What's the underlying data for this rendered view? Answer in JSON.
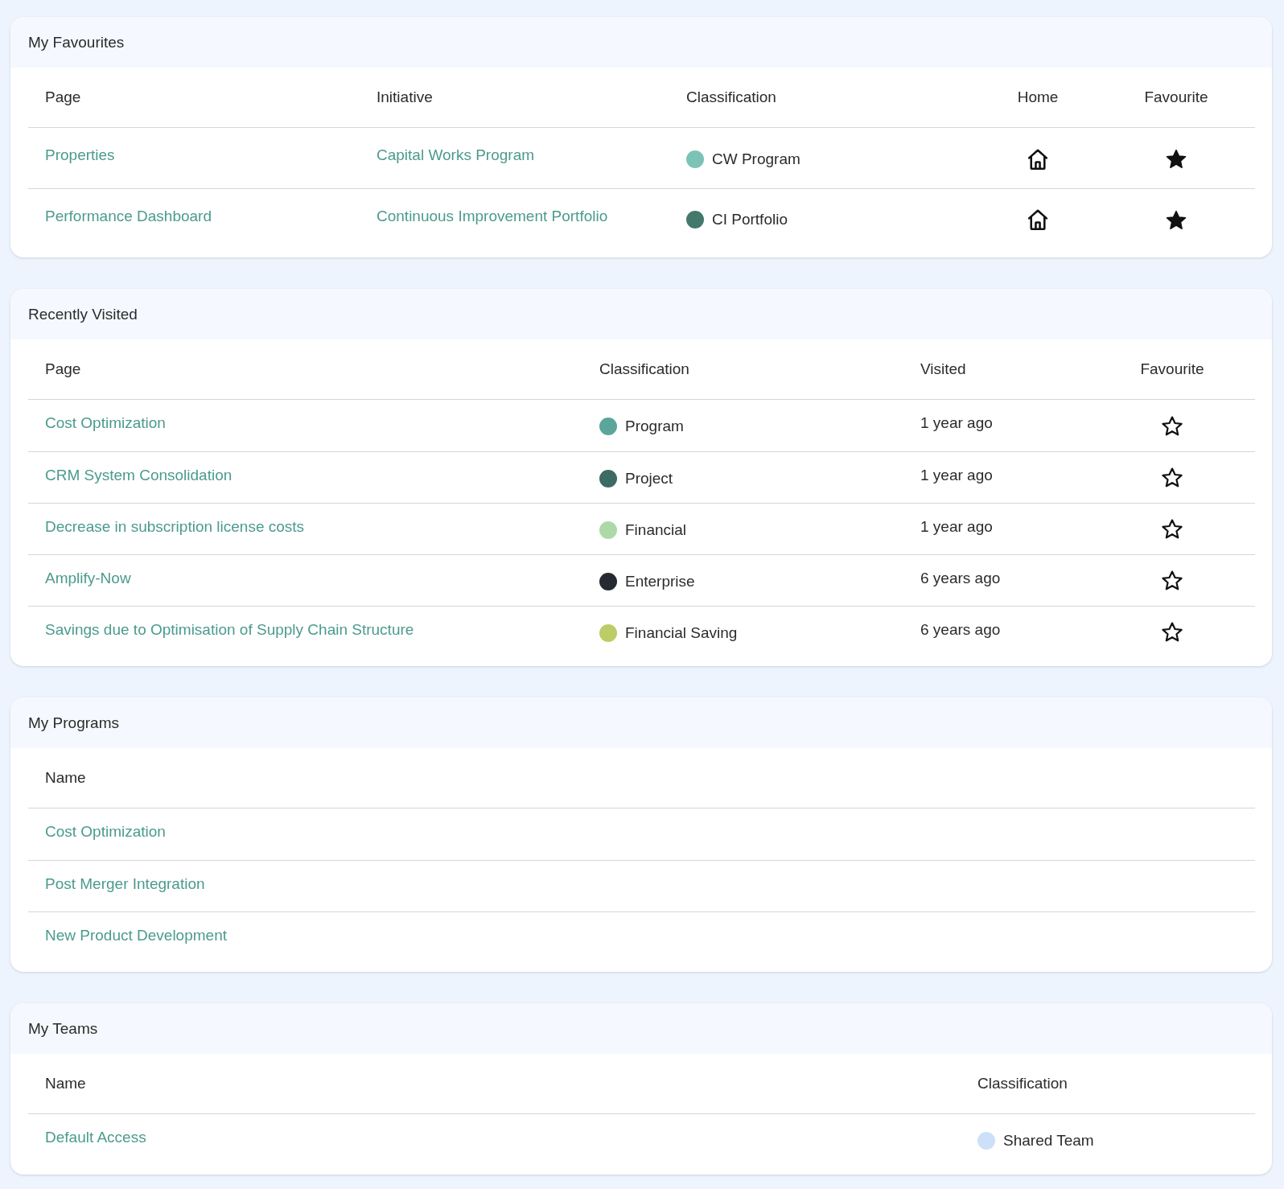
{
  "sections": [
    {
      "kind": "favourites",
      "title": "My Favourites",
      "columns": [
        {
          "label": "Page",
          "kind": "page"
        },
        {
          "label": "Initiative",
          "kind": "initiative"
        },
        {
          "label": "Classification",
          "kind": "classification"
        },
        {
          "label": "Home",
          "kind": "home"
        },
        {
          "label": "Favourite",
          "kind": "favourite"
        }
      ],
      "rows": [
        {
          "page": "Properties",
          "initiative": "Capital Works Program",
          "classification": "CW Program",
          "color": "#7cc3b7",
          "favourite": true
        },
        {
          "page": "Performance Dashboard",
          "initiative": "Continuous Improvement Portfolio",
          "classification": "CI Portfolio",
          "color": "#44786d",
          "favourite": true
        }
      ]
    },
    {
      "kind": "recent",
      "title": "Recently Visited",
      "columns": [
        {
          "label": "Page",
          "kind": "page"
        },
        {
          "label": "Classification",
          "kind": "classification"
        },
        {
          "label": "Visited",
          "kind": "visited"
        },
        {
          "label": "Favourite",
          "kind": "favourite"
        }
      ],
      "rows": [
        {
          "page": "Cost Optimization",
          "classification": "Program",
          "color": "#5ba59a",
          "visited": "1 year ago",
          "favourite": false
        },
        {
          "page": "CRM System Consolidation",
          "classification": "Project",
          "color": "#3b6b63",
          "visited": "1 year ago",
          "favourite": false
        },
        {
          "page": "Decrease in subscription license costs",
          "classification": "Financial",
          "color": "#add9a9",
          "visited": "1 year ago",
          "favourite": false
        },
        {
          "page": "Amplify-Now",
          "classification": "Enterprise",
          "color": "#252a33",
          "visited": "6 years ago",
          "favourite": false
        },
        {
          "page": "Savings due to Optimisation of Supply Chain Structure",
          "classification": "Financial Saving",
          "color": "#bccc66",
          "visited": "6 years ago",
          "favourite": false
        }
      ]
    },
    {
      "kind": "programs",
      "title": "My Programs",
      "columns": [
        {
          "label": "Name",
          "kind": "name"
        }
      ],
      "rows": [
        {
          "name": "Cost Optimization"
        },
        {
          "name": "Post Merger Integration"
        },
        {
          "name": "New Product Development"
        }
      ]
    },
    {
      "kind": "teams",
      "title": "My Teams",
      "columns": [
        {
          "label": "Name",
          "kind": "name"
        },
        {
          "label": "Classification",
          "kind": "classification"
        }
      ],
      "rows": [
        {
          "name": "Default Access",
          "classification": "Shared Team",
          "color": "#cde0f9"
        }
      ]
    }
  ]
}
